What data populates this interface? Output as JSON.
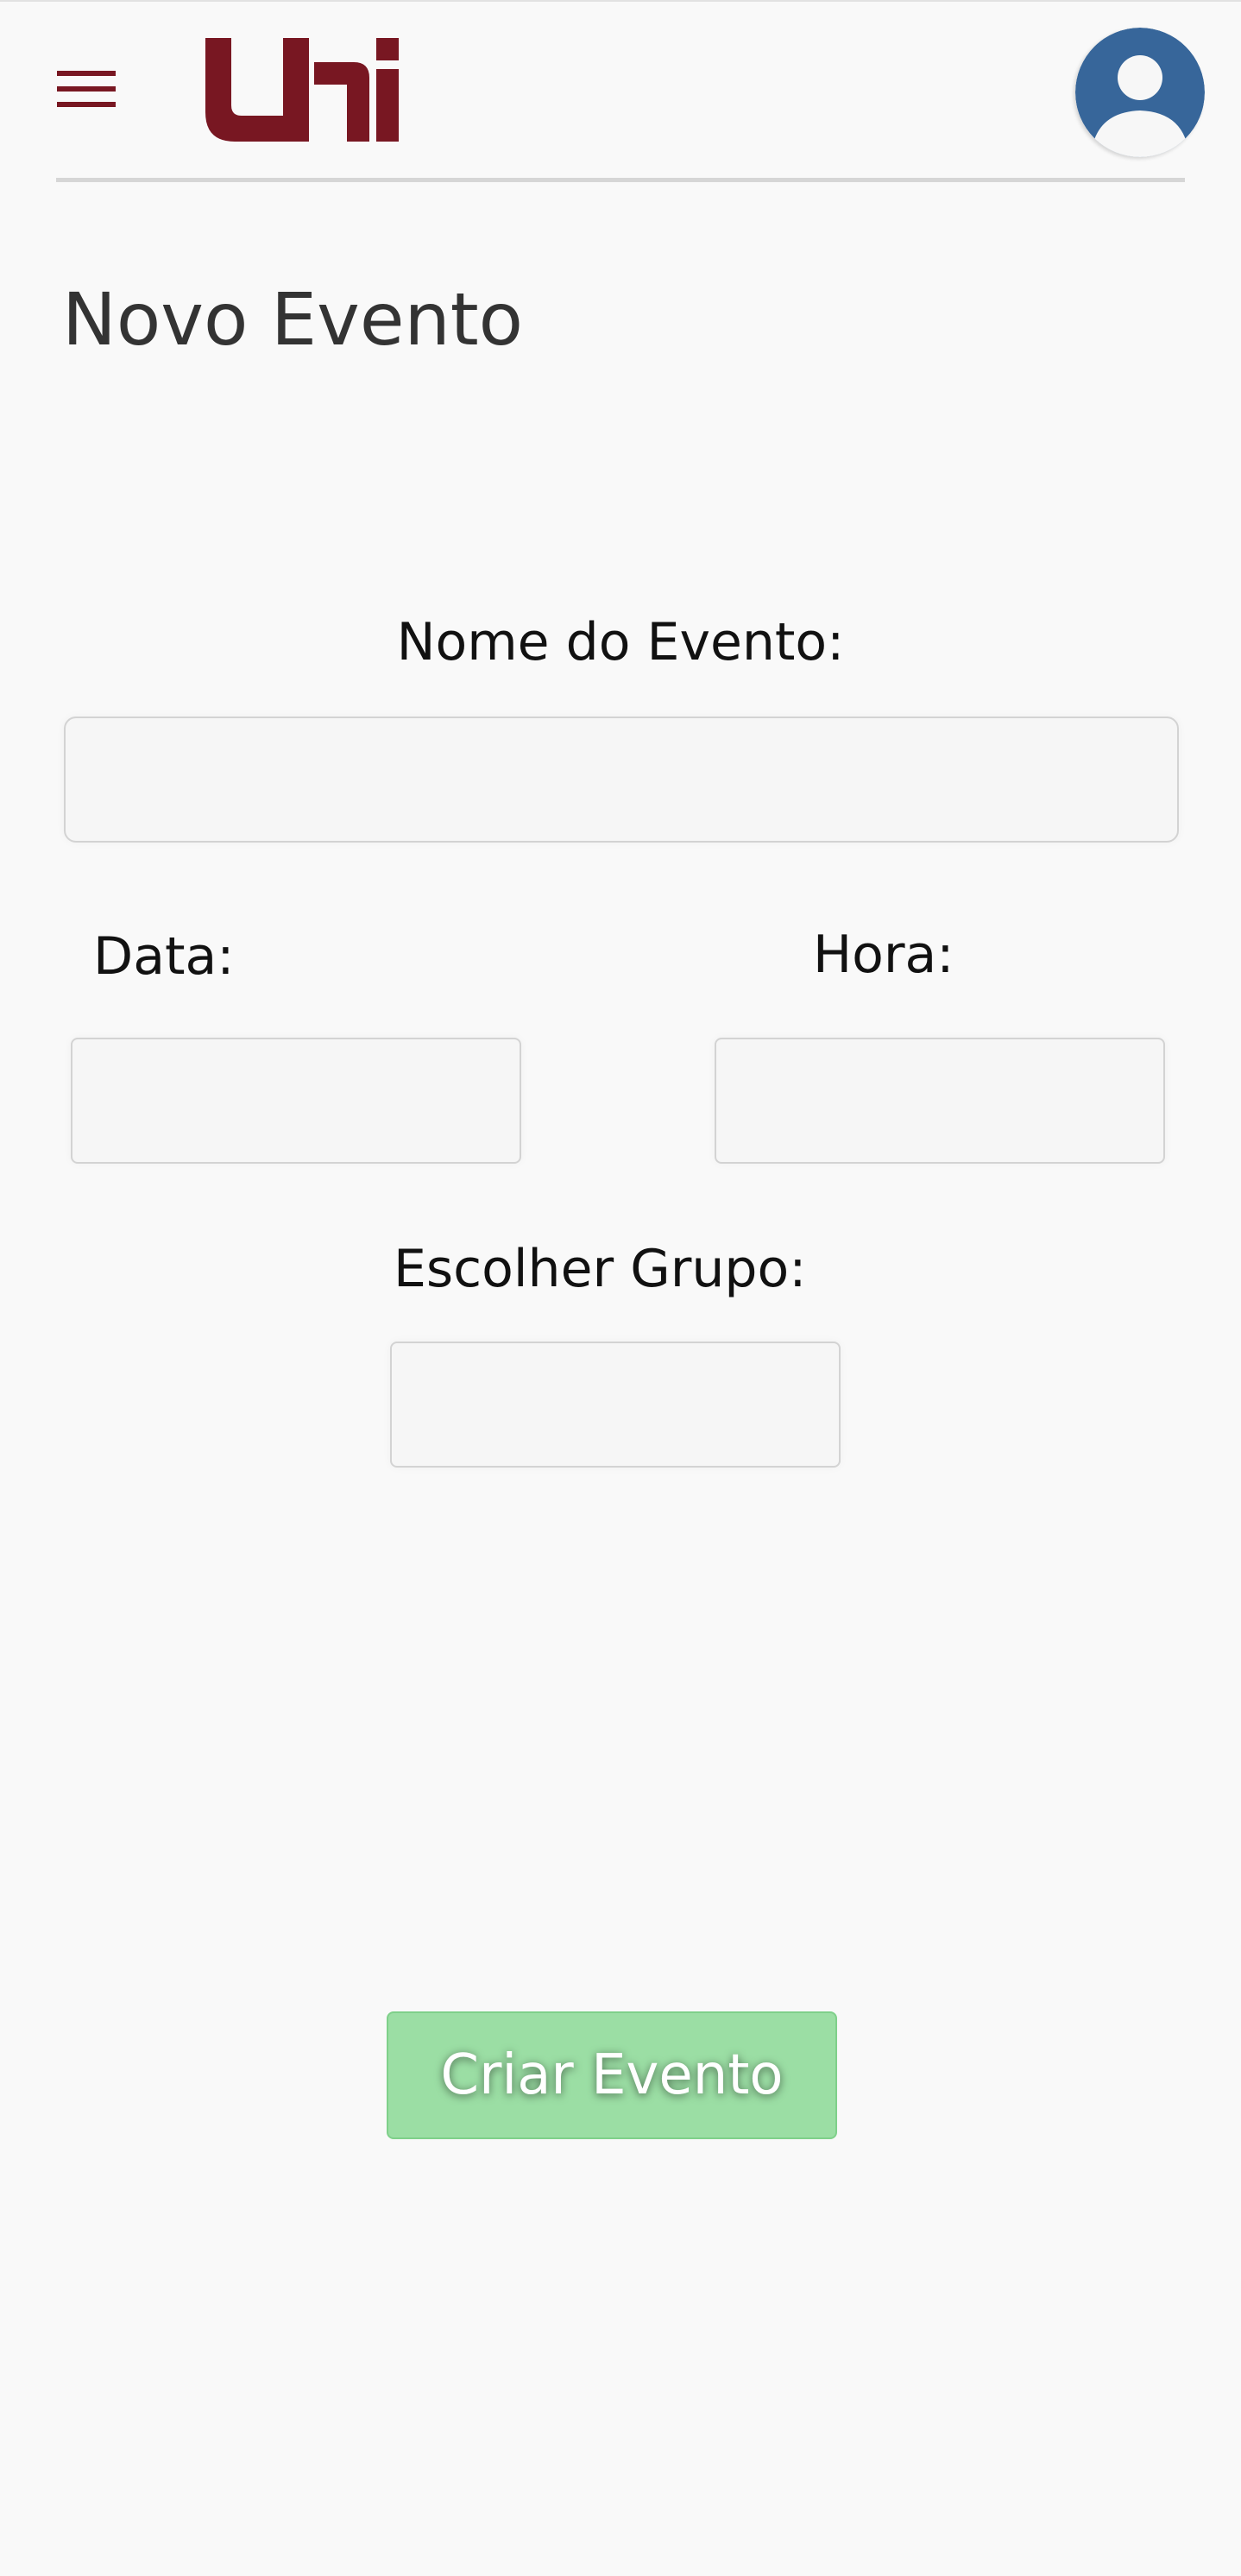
{
  "header": {
    "brand_text": "uni",
    "brand_color": "#781722",
    "menu_icon": "hamburger-menu-icon",
    "avatar_icon": "user-avatar-icon",
    "avatar_color": "#37669a"
  },
  "page": {
    "title": "Novo Evento"
  },
  "form": {
    "event_name": {
      "label": "Nome do Evento:",
      "value": "",
      "placeholder": ""
    },
    "date": {
      "label": "Data:",
      "value": "",
      "placeholder": ""
    },
    "time": {
      "label": "Hora:",
      "value": "",
      "placeholder": ""
    },
    "group": {
      "label": "Escolher Grupo:",
      "value": "",
      "placeholder": ""
    },
    "submit_label": "Criar Evento",
    "submit_color": "#9bdea4"
  }
}
